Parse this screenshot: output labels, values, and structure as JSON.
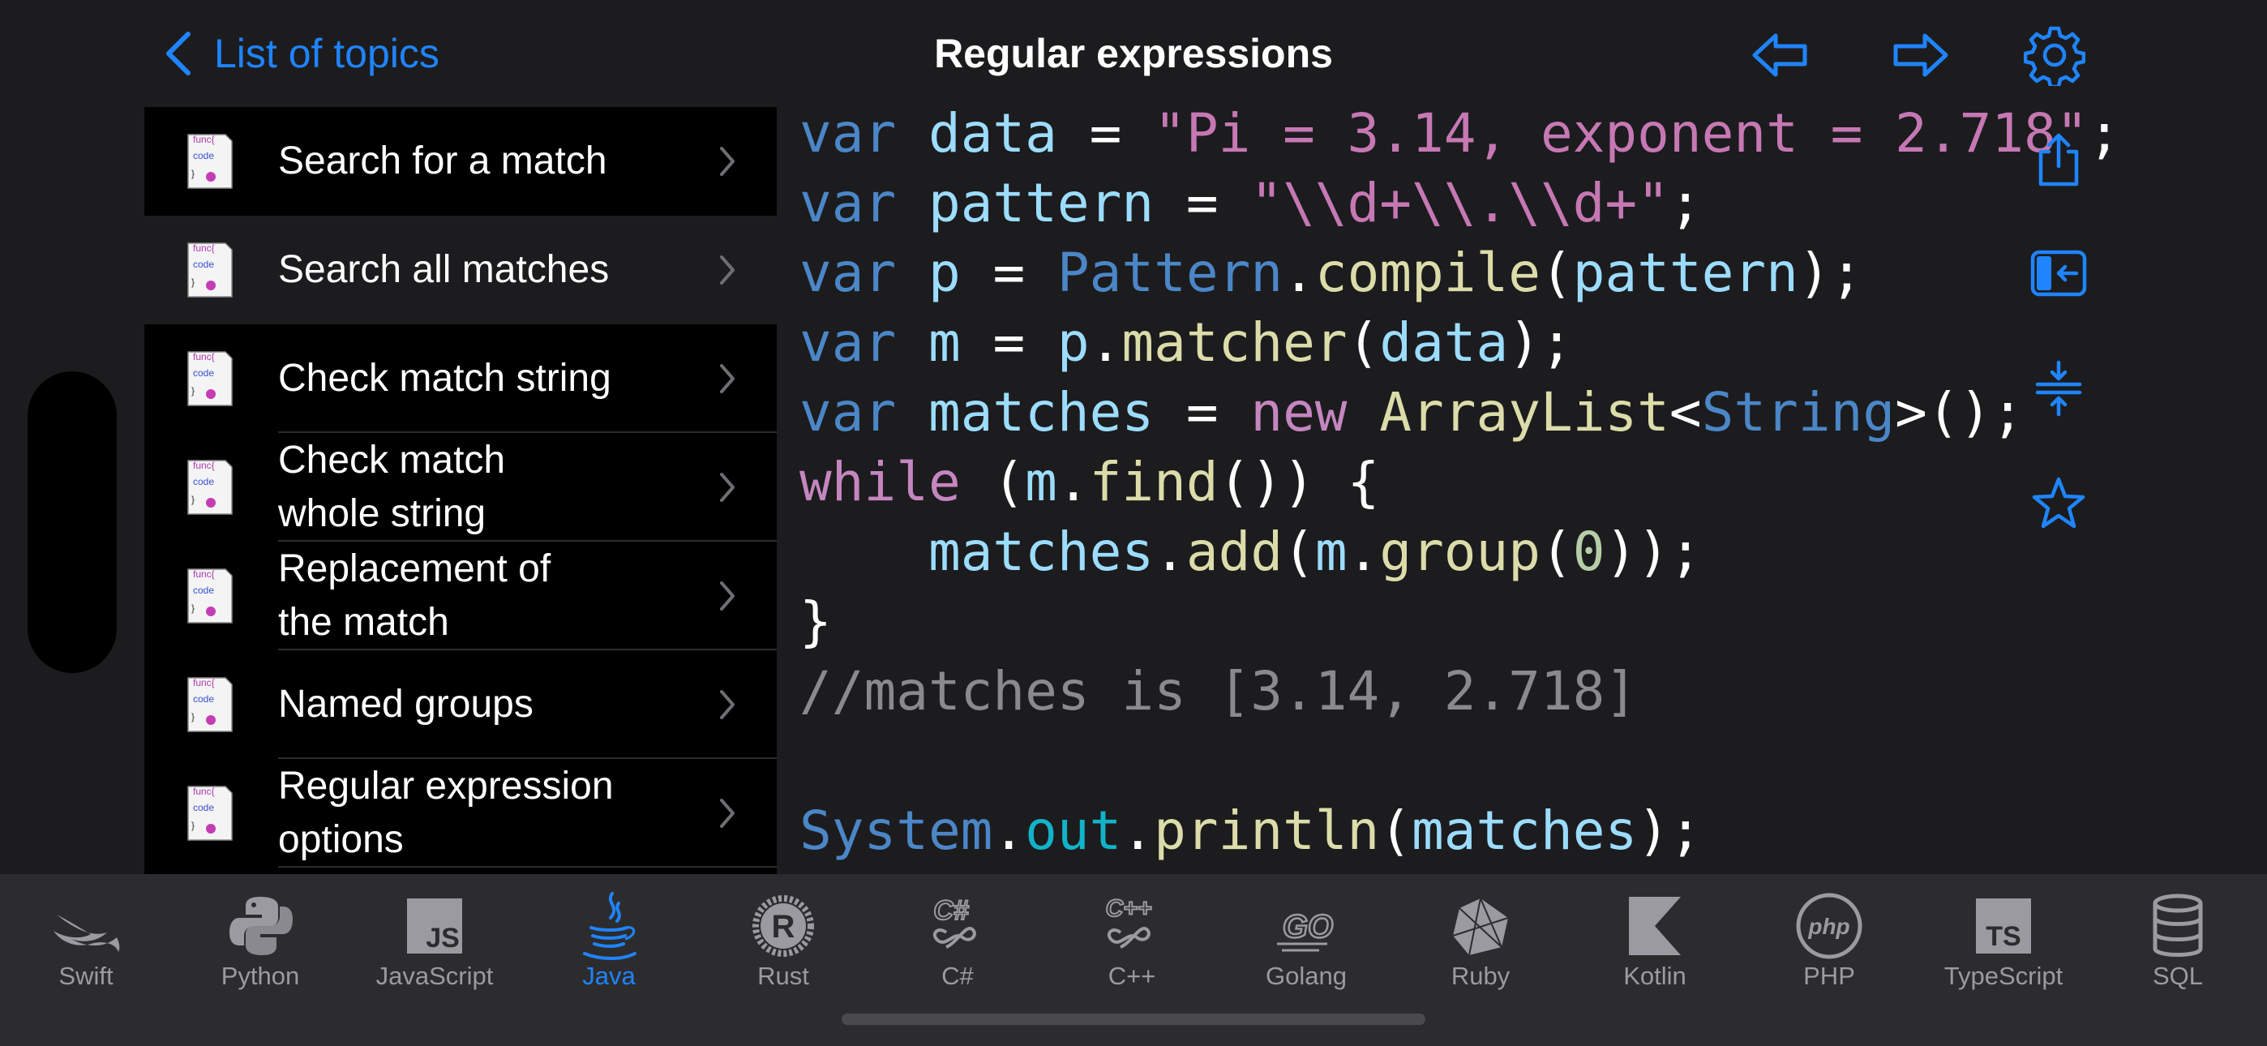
{
  "header": {
    "back_label": "List of topics",
    "title": "Regular expressions"
  },
  "colors": {
    "accent": "#1f84ff",
    "background": "#1c1c1e",
    "list_background": "#000000",
    "tabbar": "#2c2c2e"
  },
  "topics": [
    {
      "label": "Search for a match",
      "icon": "func-code-icon",
      "selected": false
    },
    {
      "label": "Search all matches",
      "icon": "func-code-icon",
      "selected": true
    },
    {
      "label": "Check match string",
      "icon": "func-code-icon",
      "selected": false
    },
    {
      "label": "Check match\nwhole string",
      "icon": "func-code-icon",
      "selected": false
    },
    {
      "label": "Replacement of\nthe match",
      "icon": "func-code-icon",
      "selected": false
    },
    {
      "label": "Named groups",
      "icon": "func-code-icon",
      "selected": false
    },
    {
      "label": "Regular expression\noptions",
      "icon": "func-code-icon",
      "selected": false
    }
  ],
  "icon_text": {
    "l1": "func{",
    "l2": "code",
    "l3": "}"
  },
  "code_lines": [
    [
      [
        "k",
        "var "
      ],
      [
        "v",
        "data"
      ],
      [
        "p",
        " = "
      ],
      [
        "s",
        "\"Pi = 3.14, exponent = 2.718\""
      ],
      [
        "p",
        ";"
      ]
    ],
    [
      [
        "k",
        "var "
      ],
      [
        "v",
        "pattern"
      ],
      [
        "p",
        " = "
      ],
      [
        "s",
        "\"\\\\d+\\\\.\\\\d+\""
      ],
      [
        "p",
        ";"
      ]
    ],
    [
      [
        "k",
        "var "
      ],
      [
        "v",
        "p"
      ],
      [
        "p",
        " = "
      ],
      [
        "t",
        "Pattern"
      ],
      [
        "p",
        "."
      ],
      [
        "f",
        "compile"
      ],
      [
        "p",
        "("
      ],
      [
        "v",
        "pattern"
      ],
      [
        "p",
        ");"
      ]
    ],
    [
      [
        "k",
        "var "
      ],
      [
        "v",
        "m"
      ],
      [
        "p",
        " = "
      ],
      [
        "v",
        "p"
      ],
      [
        "p",
        "."
      ],
      [
        "f",
        "matcher"
      ],
      [
        "p",
        "("
      ],
      [
        "v",
        "data"
      ],
      [
        "p",
        ");"
      ]
    ],
    [
      [
        "k",
        "var "
      ],
      [
        "v",
        "matches"
      ],
      [
        "p",
        " = "
      ],
      [
        "kp",
        "new "
      ],
      [
        "f",
        "ArrayList"
      ],
      [
        "p",
        "<"
      ],
      [
        "t",
        "String"
      ],
      [
        "p",
        ">();"
      ]
    ],
    [
      [
        "kp",
        "while"
      ],
      [
        "p",
        " ("
      ],
      [
        "v",
        "m"
      ],
      [
        "p",
        "."
      ],
      [
        "f",
        "find"
      ],
      [
        "p",
        "()) {"
      ]
    ],
    [
      [
        "p",
        "    "
      ],
      [
        "v",
        "matches"
      ],
      [
        "p",
        "."
      ],
      [
        "f",
        "add"
      ],
      [
        "p",
        "("
      ],
      [
        "v",
        "m"
      ],
      [
        "p",
        "."
      ],
      [
        "f",
        "group"
      ],
      [
        "p",
        "("
      ],
      [
        "n",
        "0"
      ],
      [
        "p",
        "));"
      ]
    ],
    [
      [
        "p",
        "}"
      ]
    ],
    [
      [
        "c",
        "//matches is [3.14, 2.718]"
      ]
    ],
    [],
    [
      [
        "k",
        "System"
      ],
      [
        "p",
        "."
      ],
      [
        "o",
        "out"
      ],
      [
        "p",
        "."
      ],
      [
        "f",
        "println"
      ],
      [
        "p",
        "("
      ],
      [
        "v",
        "matches"
      ],
      [
        "p",
        ");"
      ]
    ]
  ],
  "side_actions": [
    {
      "name": "share-icon"
    },
    {
      "name": "sidebar-toggle-icon"
    },
    {
      "name": "collapse-icon"
    },
    {
      "name": "favorite-star-icon"
    }
  ],
  "tabs": [
    {
      "label": "Swift",
      "icon": "swift-icon",
      "active": false
    },
    {
      "label": "Python",
      "icon": "python-icon",
      "active": false
    },
    {
      "label": "JavaScript",
      "icon": "javascript-icon",
      "active": false
    },
    {
      "label": "Java",
      "icon": "java-icon",
      "active": true
    },
    {
      "label": "Rust",
      "icon": "rust-icon",
      "active": false
    },
    {
      "label": "C#",
      "icon": "csharp-icon",
      "active": false
    },
    {
      "label": "C++",
      "icon": "cpp-icon",
      "active": false
    },
    {
      "label": "Golang",
      "icon": "golang-icon",
      "active": false
    },
    {
      "label": "Ruby",
      "icon": "ruby-icon",
      "active": false
    },
    {
      "label": "Kotlin",
      "icon": "kotlin-icon",
      "active": false
    },
    {
      "label": "PHP",
      "icon": "php-icon",
      "active": false
    },
    {
      "label": "TypeScript",
      "icon": "typescript-icon",
      "active": false
    },
    {
      "label": "SQL",
      "icon": "sql-icon",
      "active": false
    }
  ],
  "tab_icon_text": {
    "js": "JS",
    "csharp": "C#",
    "cpp": "C++",
    "go": "GO",
    "php": "php",
    "ts": "TS",
    "rust": "R"
  }
}
